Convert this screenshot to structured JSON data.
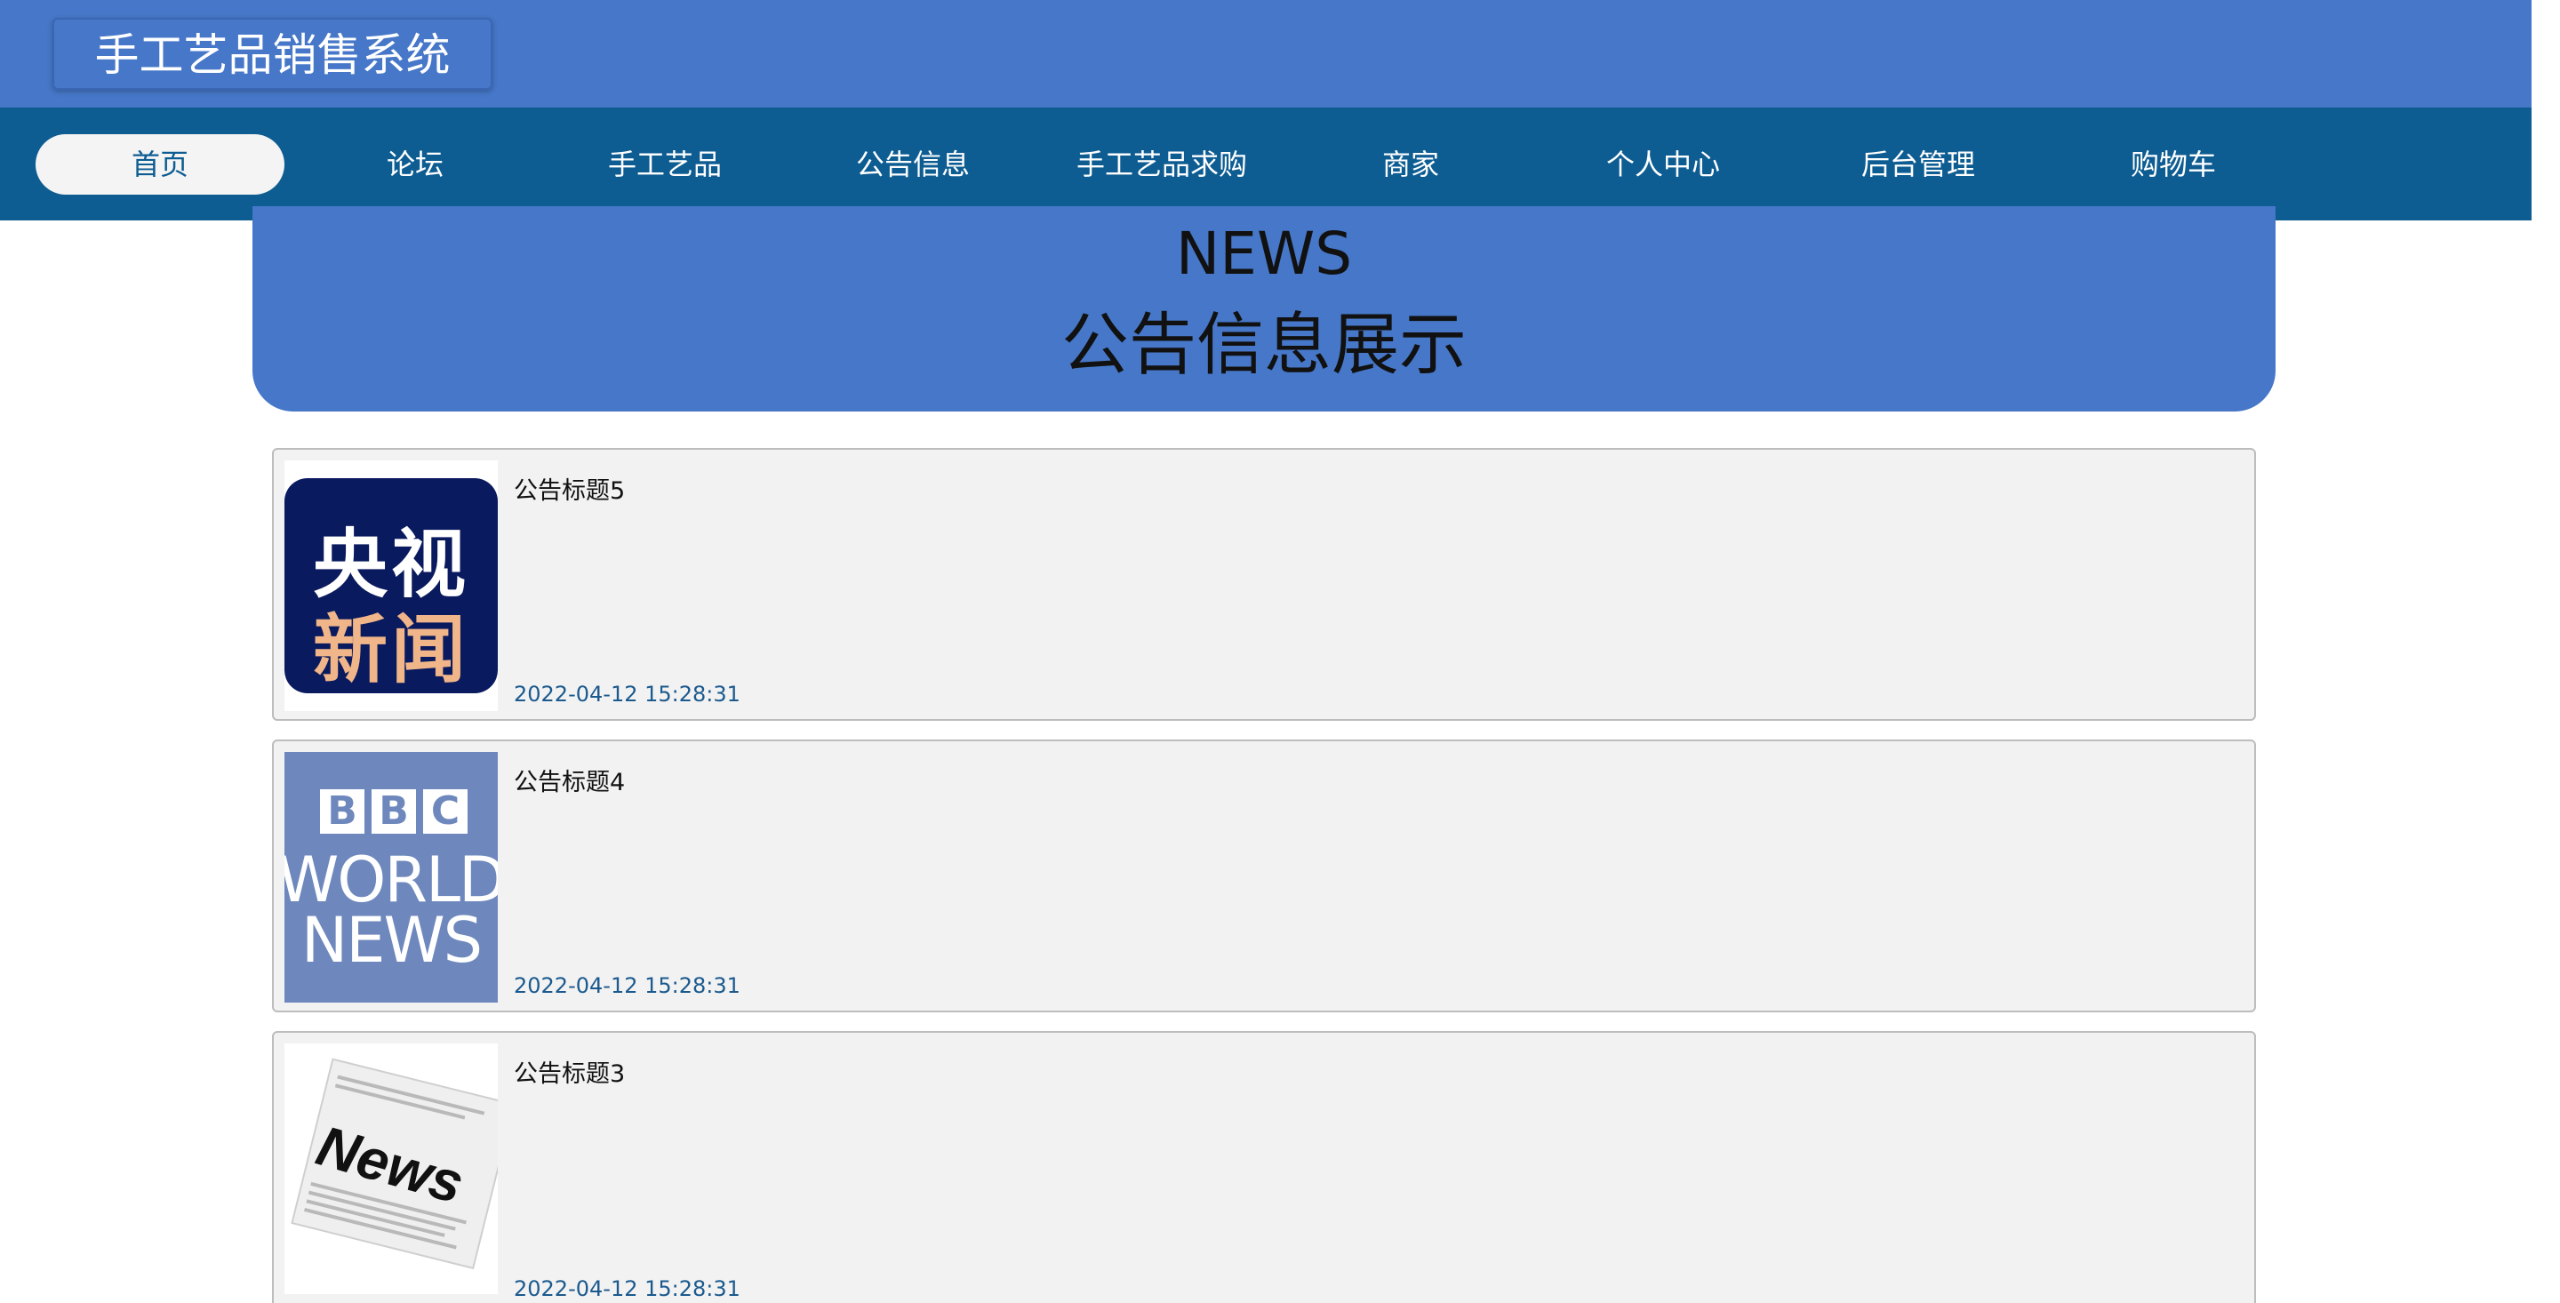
{
  "header": {
    "title": "手工艺品销售系统"
  },
  "nav": {
    "items": [
      {
        "label": "首页",
        "active": true
      },
      {
        "label": "论坛"
      },
      {
        "label": "手工艺品"
      },
      {
        "label": "公告信息"
      },
      {
        "label": "手工艺品求购"
      },
      {
        "label": "商家"
      },
      {
        "label": "个人中心"
      },
      {
        "label": "后台管理"
      },
      {
        "label": "购物车"
      }
    ]
  },
  "banner": {
    "english": "NEWS",
    "chinese": "公告信息展示"
  },
  "news": [
    {
      "title": "公告标题5",
      "time": "2022-04-12 15:28:31",
      "thumb_text_1": "央视",
      "thumb_text_2": "新闻"
    },
    {
      "title": "公告标题4",
      "time": "2022-04-12 15:28:31",
      "thumb_letters": [
        "B",
        "B",
        "C"
      ],
      "thumb_line_1": "WORLD",
      "thumb_line_2": "NEWS"
    },
    {
      "title": "公告标题3",
      "time": "2022-04-12 15:28:31",
      "thumb_text": "News"
    }
  ],
  "colors": {
    "header_bg": "#4677c8",
    "nav_bg": "#0d5c92",
    "card_bg": "#f2f2f2",
    "time_color": "#1b5a8e"
  }
}
